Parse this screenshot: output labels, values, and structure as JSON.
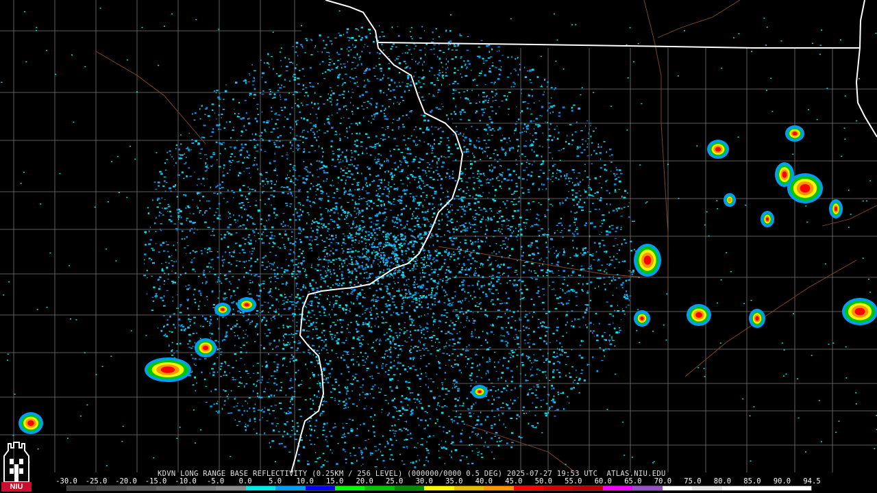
{
  "product_header": "KDVN LONG RANGE BASE REFLECTIVITY (0.25KM / 256 LEVEL) (000000/0000 0.5 DEG) 2025-07-27 19:53 UTC  ATLAS.NIU.EDU",
  "logo_text": "NIU",
  "scale": {
    "labels": [
      "-30.0",
      "-25.0",
      "-20.0",
      "-15.0",
      "-10.0",
      "-5.0",
      "0.0",
      "5.0",
      "10.0",
      "15.0",
      "20.0",
      "25.0",
      "30.0",
      "35.0",
      "40.0",
      "45.0",
      "50.0",
      "55.0",
      "60.0",
      "65.0",
      "70.0",
      "75.0",
      "80.0",
      "85.0",
      "90.0",
      "94.5"
    ],
    "colors": [
      "#3a3a3a",
      "#4a4a4a",
      "#5a5a5a",
      "#6a6a6a",
      "#7a7a7a",
      "#8a8a8a",
      "#04e9e7",
      "#019ff4",
      "#0300f4",
      "#02fd02",
      "#01c501",
      "#008e00",
      "#fdf802",
      "#e5bc00",
      "#fd9500",
      "#fd0000",
      "#d40000",
      "#bc0000",
      "#f800fd",
      "#9854c6",
      "#fdfdfd",
      "#e6e6e6",
      "#ffffff",
      "#ffffff",
      "#ffffff"
    ]
  },
  "colors": {
    "background": "#000000",
    "state_border": "#ffffff",
    "county_border": "#7a7a7a",
    "highway": "#8b4a2b",
    "clear_air_light": "#04e9e7",
    "clear_air_dark": "#019ff4"
  },
  "radar_site": "KDVN"
}
